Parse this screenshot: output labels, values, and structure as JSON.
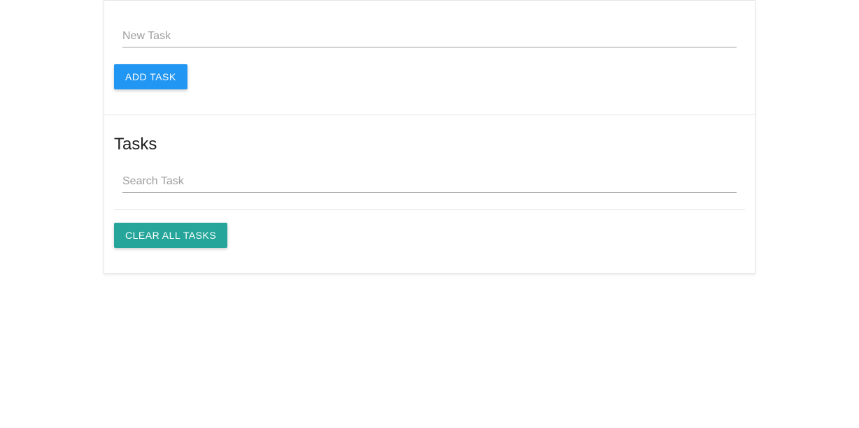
{
  "newTask": {
    "placeholder": "New Task",
    "value": ""
  },
  "addTaskButton": {
    "label": "Add Task"
  },
  "tasksSection": {
    "title": "Tasks"
  },
  "searchTask": {
    "placeholder": "Search Task",
    "value": ""
  },
  "clearAllButton": {
    "label": "Clear All Tasks"
  }
}
